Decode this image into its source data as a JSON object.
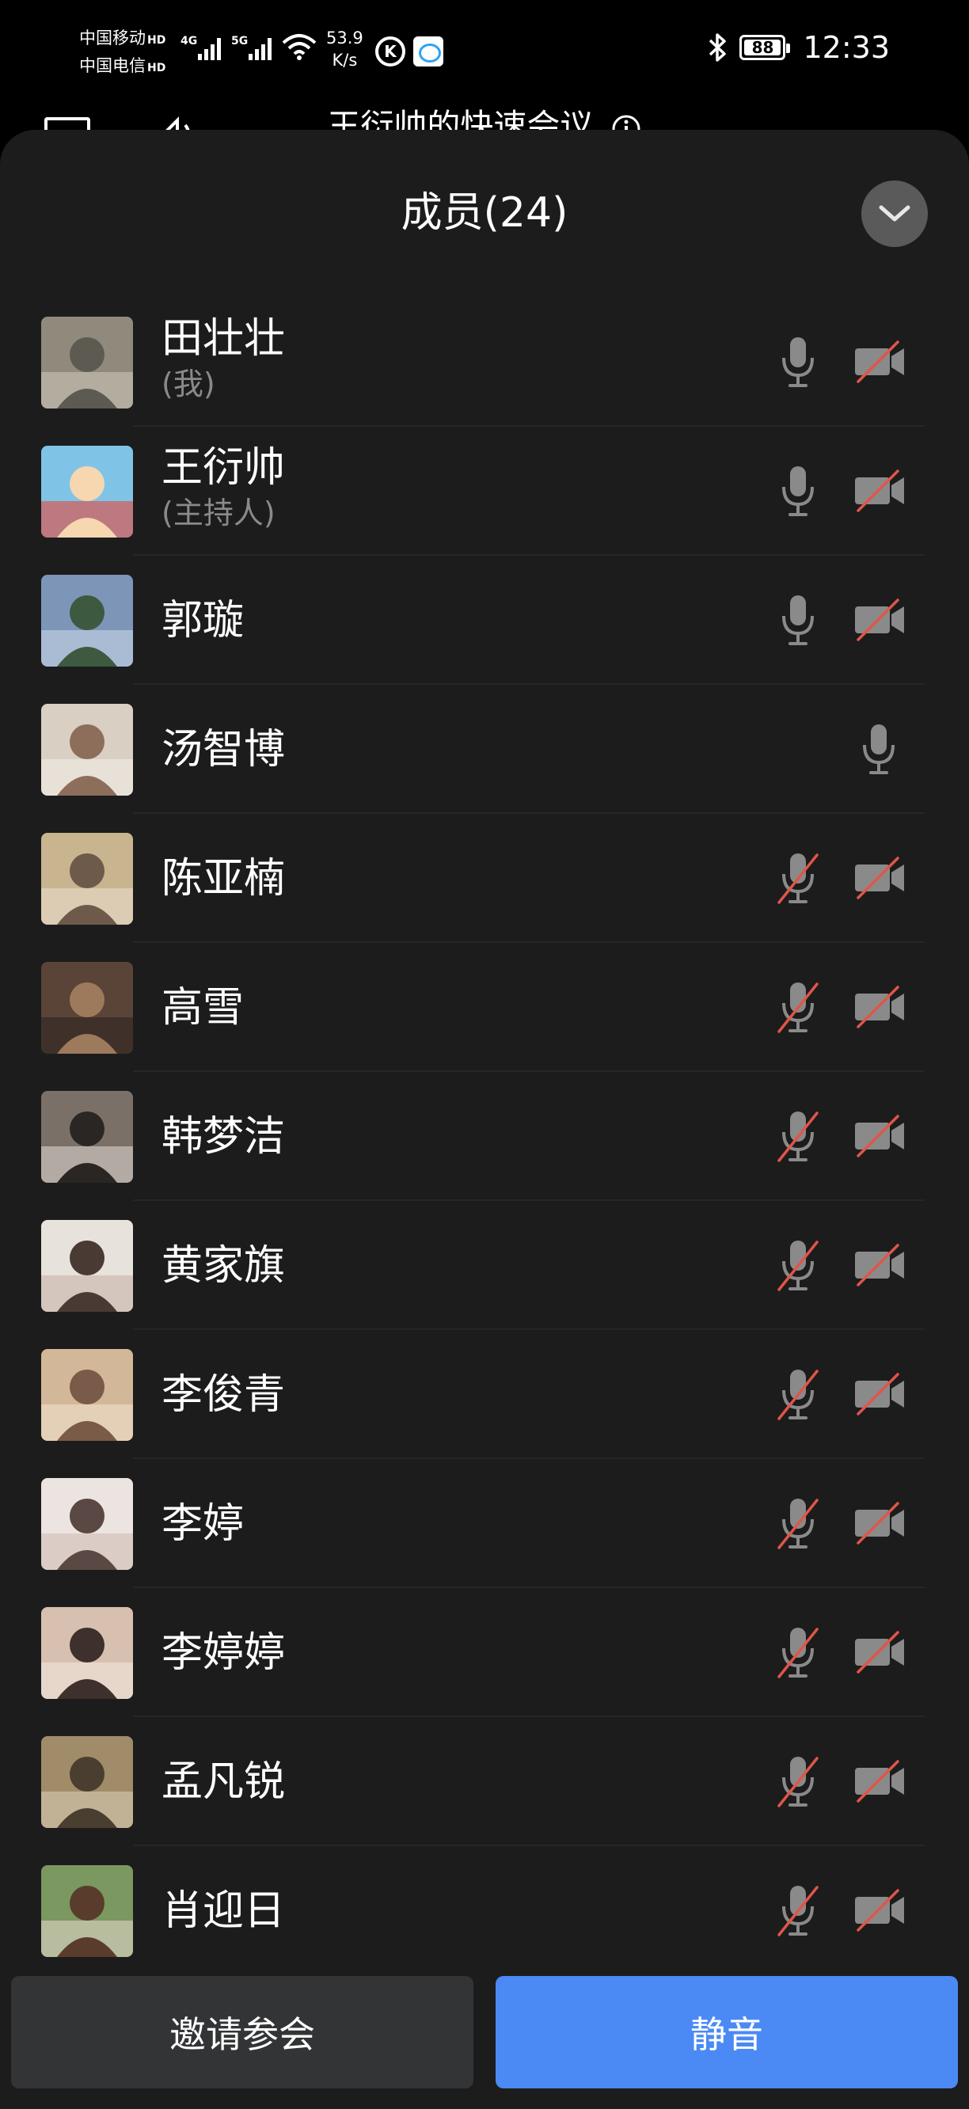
{
  "status_bar": {
    "carrier1": "中国移动",
    "carrier2": "中国电信",
    "hd": "HD",
    "net1": "4G",
    "net2": "5G",
    "speed_value": "53.9",
    "speed_unit": "K/s",
    "battery": "88",
    "time": "12:33"
  },
  "background_header": {
    "title": "王衍帅的快速会议"
  },
  "panel": {
    "title": "成员(24)",
    "collapse_icon": "chevron-down-icon"
  },
  "members": [
    {
      "name": "田壮壮",
      "sub": "(我)",
      "mic": "on",
      "cam": "off"
    },
    {
      "name": "王衍帅",
      "sub": "(主持人)",
      "mic": "on",
      "cam": "off"
    },
    {
      "name": "郭璇",
      "sub": "",
      "mic": "on",
      "cam": "off"
    },
    {
      "name": "汤智博",
      "sub": "",
      "mic": "on",
      "cam": "none"
    },
    {
      "name": "陈亚楠",
      "sub": "",
      "mic": "off",
      "cam": "off"
    },
    {
      "name": "高雪",
      "sub": "",
      "mic": "off",
      "cam": "off"
    },
    {
      "name": "韩梦洁",
      "sub": "",
      "mic": "off",
      "cam": "off"
    },
    {
      "name": "黄家旗",
      "sub": "",
      "mic": "off",
      "cam": "off"
    },
    {
      "name": "李俊青",
      "sub": "",
      "mic": "off",
      "cam": "off"
    },
    {
      "name": "李婷",
      "sub": "",
      "mic": "off",
      "cam": "off"
    },
    {
      "name": "李婷婷",
      "sub": "",
      "mic": "off",
      "cam": "off"
    },
    {
      "name": "孟凡锐",
      "sub": "",
      "mic": "off",
      "cam": "off"
    },
    {
      "name": "肖迎日",
      "sub": "",
      "mic": "off",
      "cam": "off"
    }
  ],
  "buttons": {
    "invite": "邀请参会",
    "mute_all": "静音"
  },
  "colors": {
    "accent": "#4b8af4",
    "muted_slash": "#e0554a",
    "panel_bg": "#1c1c1c",
    "icon_gray": "#8a8a8a"
  }
}
